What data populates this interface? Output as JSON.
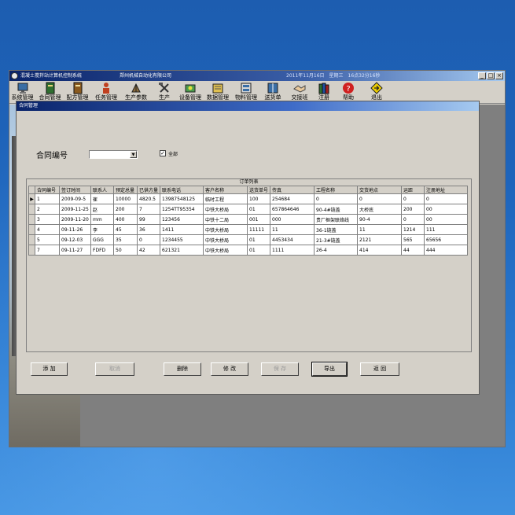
{
  "window": {
    "title": "混凝土搅拌站计算机控制系统",
    "company": "郑州机械自动化有限公司",
    "datetime": "2011年11月16日　星期三　16点32分16秒",
    "controls": [
      "_",
      "□",
      "×"
    ]
  },
  "toolbar": [
    {
      "label": "系统管理",
      "icon": "monitor-icon"
    },
    {
      "label": "合同管理",
      "icon": "contract-book-icon"
    },
    {
      "label": "配方管理",
      "icon": "recipe-book-icon"
    },
    {
      "label": "任务管理",
      "icon": "task-person-icon"
    },
    {
      "label": "生产参数",
      "icon": "parameters-icon"
    },
    {
      "label": "生产",
      "icon": "tools-icon"
    },
    {
      "label": "设备管理",
      "icon": "device-icon"
    },
    {
      "label": "数据管理",
      "icon": "data-notebook-icon"
    },
    {
      "label": "物料管理",
      "icon": "material-icon"
    },
    {
      "label": "送货单",
      "icon": "delivery-book-icon"
    },
    {
      "label": "交接班",
      "icon": "handshake-icon"
    },
    {
      "label": "注册",
      "icon": "register-books-icon"
    },
    {
      "label": "帮助",
      "icon": "help-icon"
    },
    {
      "label": "退出",
      "icon": "exit-sign-icon"
    }
  ],
  "dialog": {
    "title": "合同管理",
    "filter_label": "合同编号",
    "combo_value": "",
    "checkbox_checked": true,
    "checkbox_mark": "✓",
    "checkbox_label": "全部",
    "grid_caption": "订单列表",
    "columns": [
      "合同编号",
      "签订时间",
      "联系人",
      "预定总量",
      "已供方量",
      "联系电话",
      "客户名称",
      "送货单号",
      "传真",
      "工程名称",
      "交货地点",
      "运距",
      "注册地址"
    ],
    "rows": [
      [
        "1",
        "2009-09-5",
        "崔",
        "10000",
        "4820.5",
        "13987548125",
        "临时工程",
        "100",
        "254684",
        "0",
        "0",
        "0",
        "0"
      ],
      [
        "2",
        "2009-11-25",
        "赵",
        "200",
        "7",
        "1254TT95354",
        "中铁大桥局",
        "01",
        "657864646",
        "90-4#链盖",
        "大桥底",
        "200",
        "00"
      ],
      [
        "3",
        "2009-11-20",
        "mm",
        "400",
        "99",
        "123456",
        "中铁十二局",
        "001",
        "000",
        "贵厂框架联络线",
        "90-4",
        "0",
        "00"
      ],
      [
        "4",
        "09-11-26",
        "李",
        "45",
        "36",
        "1411",
        "中铁大桥局",
        "11111",
        "11",
        "36-1链盖",
        "11",
        "1214",
        "111"
      ],
      [
        "5",
        "09-12-03",
        "GGG",
        "35",
        "0",
        "1234455",
        "中铁大桥局",
        "01",
        "4453434",
        "21-3#链盖",
        "2121",
        "565",
        "65656"
      ],
      [
        "7",
        "09-11-27",
        "FDFD",
        "50",
        "42",
        "621321",
        "中铁大桥局",
        "01",
        "1111",
        "26-4",
        "414",
        "44",
        "444"
      ]
    ],
    "current_row_marker": "▶",
    "buttons": {
      "add": "添 加",
      "cancel": "取消",
      "delete": "删除",
      "modify": "修 改",
      "save": "保 存",
      "export": "导出",
      "back": "返 回"
    }
  }
}
